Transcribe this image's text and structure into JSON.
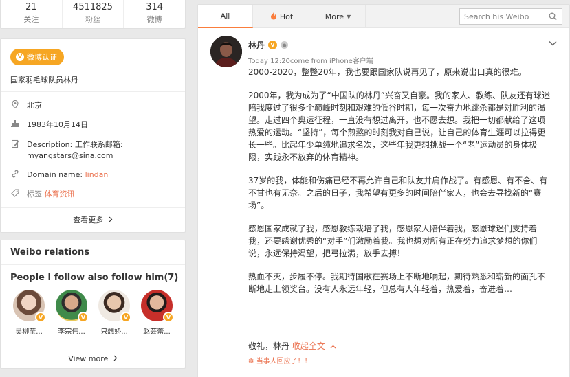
{
  "stats": [
    {
      "value": "21",
      "label": "关注"
    },
    {
      "value": "4511825",
      "label": "粉丝"
    },
    {
      "value": "314",
      "label": "微博"
    }
  ],
  "profile": {
    "verify_label": "微博认证",
    "bio": "国家羽毛球队员林丹",
    "location": "北京",
    "birthday": "1983年10月14日",
    "description_label": "Description:",
    "description_value": "工作联系邮箱:",
    "description_email": "myangstars@sina.com",
    "domain_label": "Domain name:",
    "domain_value": "lindan",
    "tag_label": "标签",
    "tag_value": "体育资讯",
    "more_label": "查看更多"
  },
  "relations": {
    "title": "Weibo relations",
    "subtitle": "People I follow also follow him(7)",
    "people": [
      {
        "name": "吴柳莹...",
        "color": "#c9a08a"
      },
      {
        "name": "李宗伟...",
        "color": "#4a7b4c"
      },
      {
        "name": "只想娇...",
        "color": "#c8b39b"
      },
      {
        "name": "赵芸蕾...",
        "color": "#b8413c"
      }
    ],
    "view_more": "View more"
  },
  "feed": {
    "tabs": {
      "all": "All",
      "hot": "Hot",
      "more": "More"
    },
    "search_placeholder": "Search his Weibo",
    "post": {
      "author": "林丹",
      "time": "Today 12:20come from iPhone客户端",
      "paragraphs": [
        "2000-2020，整整20年，我也要跟国家队说再见了，原来说出口真的很难。",
        "2000年，我为成为了“中国队的林丹”兴奋又自豪。我的家人、教练、队友还有球迷陪我度过了很多个巅峰时刻和艰难的低谷时期，每一次奋力地跳杀都是对胜利的渴望。走过四个奥运征程，一直没有想过离开，也不愿去想。我把一切都献给了这项热爱的运动。“坚持”，每个煎熬的时刻我对自己说，让自己的体育生涯可以拉得更长一些。比起年少单纯地追求名次，这些年我更想挑战一个“老”运动员的身体极限，实践永不放弃的体育精神。",
        "37岁的我，体能和伤痛已经不再允许自己和队友并肩作战了。有感恩、有不舍、有不甘也有无奈。之后的日子，我希望有更多的时间陪伴家人，也会去寻找新的“赛场”。",
        "感恩国家成就了我，感恩教练栽培了我，感恩家人陪伴着我，感恩球迷们支持着我，还要感谢优秀的“对手”们激励着我。我也想对所有正在努力追求梦想的你们说，永远保持渴望，把弓拉满，放手去搏！",
        "热血不灭，步履不停。我期待国歌在赛场上不断地响起，期待熟悉和崭新的面孔不断地走上领奖台。没有人永远年轻，但总有人年轻着，热爱着，奋进着…"
      ],
      "sign": "敬礼，林丹",
      "collapse": "收起全文",
      "reply": "当事人回应了！！"
    }
  },
  "colors": {
    "accent": "#eb7350",
    "verify": "#f6a623",
    "tab_underline": "#fa7d3c"
  }
}
